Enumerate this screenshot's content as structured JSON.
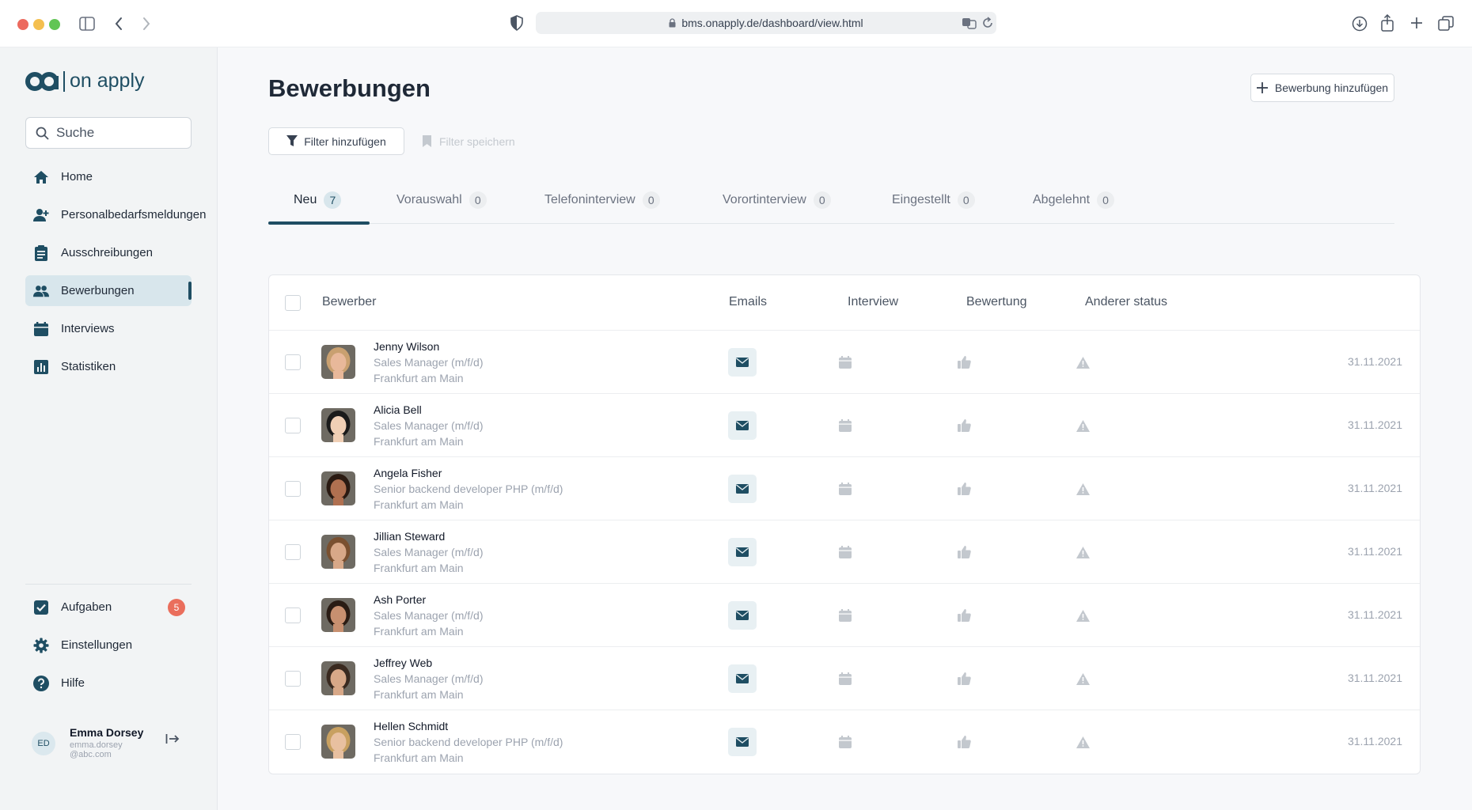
{
  "browser": {
    "url": "bms.onapply.de/dashboard/view.html"
  },
  "sidebar": {
    "logo_text": "on apply",
    "search_placeholder": "Suche",
    "nav": [
      {
        "label": "Home",
        "icon": "home-icon"
      },
      {
        "label": "Personalbedarfsmeldungen",
        "icon": "add-person-icon"
      },
      {
        "label": "Ausschreibungen",
        "icon": "clipboard-icon"
      },
      {
        "label": "Bewerbungen",
        "icon": "people-icon",
        "active": true
      },
      {
        "label": "Interviews",
        "icon": "calendar-icon"
      },
      {
        "label": "Statistiken",
        "icon": "bar-chart-icon"
      }
    ],
    "bottom_nav": [
      {
        "label": "Aufgaben",
        "icon": "checkbox-icon",
        "badge": "5"
      },
      {
        "label": "Einstellungen",
        "icon": "gear-icon"
      },
      {
        "label": "Hilfe",
        "icon": "help-icon"
      }
    ],
    "user": {
      "initials": "ED",
      "name": "Emma Dorsey",
      "email": "emma.dorsey@abc.com"
    }
  },
  "main": {
    "title": "Bewerbungen",
    "add_button": "Bewerbung hinzufügen",
    "filter_button": "Filter hinzufügen",
    "save_filter": "Filter speichern",
    "tabs": [
      {
        "label": "Neu",
        "count": "7",
        "active": true
      },
      {
        "label": "Vorauswahl",
        "count": "0"
      },
      {
        "label": "Telefoninterview",
        "count": "0"
      },
      {
        "label": "Vorortinterview",
        "count": "0"
      },
      {
        "label": "Eingestellt",
        "count": "0"
      },
      {
        "label": "Abgelehnt",
        "count": "0"
      }
    ],
    "columns": {
      "applicant": "Bewerber",
      "emails": "Emails",
      "interview": "Interview",
      "rating": "Bewertung",
      "other_status": "Anderer status"
    },
    "rows": [
      {
        "name": "Jenny Wilson",
        "role": "Sales Manager (m/f/d)",
        "location": "Frankfurt am Main",
        "date": "31.11.2021",
        "skin": "#e8b89a",
        "hair": "#c9a070"
      },
      {
        "name": "Alicia Bell",
        "role": "Sales Manager (m/f/d)",
        "location": "Frankfurt am Main",
        "date": "31.11.2021",
        "skin": "#f0cfb5",
        "hair": "#1a1a1a"
      },
      {
        "name": "Angela Fisher",
        "role": "Senior backend developer PHP (m/f/d)",
        "location": "Frankfurt am Main",
        "date": "31.11.2021",
        "skin": "#b07050",
        "hair": "#2a1a12"
      },
      {
        "name": "Jillian Steward",
        "role": "Sales Manager (m/f/d)",
        "location": "Frankfurt am Main",
        "date": "31.11.2021",
        "skin": "#d8a888",
        "hair": "#7a5030"
      },
      {
        "name": "Ash Porter",
        "role": "Sales Manager (m/f/d)",
        "location": "Frankfurt am Main",
        "date": "31.11.2021",
        "skin": "#c89070",
        "hair": "#2a1c14"
      },
      {
        "name": "Jeffrey Web",
        "role": "Sales Manager (m/f/d)",
        "location": "Frankfurt am Main",
        "date": "31.11.2021",
        "skin": "#d8a888",
        "hair": "#3a2a20"
      },
      {
        "name": "Hellen Schmidt",
        "role": "Senior backend developer PHP (m/f/d)",
        "location": "Frankfurt am Main",
        "date": "31.11.2021",
        "skin": "#e8c0a0",
        "hair": "#c8a060"
      }
    ]
  },
  "colors": {
    "brand": "#1f4e63",
    "active_bg": "#d8e6ec",
    "badge": "#ea6e5c",
    "muted_icon": "#c3c8ce"
  }
}
